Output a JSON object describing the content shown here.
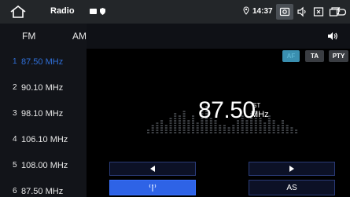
{
  "statusbar": {
    "title": "Radio",
    "time": "14:37",
    "icons": [
      "home-icon",
      "sd-card-icon",
      "shield-icon",
      "location-icon",
      "screenshot-icon",
      "volume-icon",
      "close-window-icon",
      "window-icon",
      "back-icon"
    ]
  },
  "bands": {
    "fm": "FM",
    "am": "AM"
  },
  "presets": [
    {
      "num": "1",
      "freq": "87.50 MHz",
      "active": true
    },
    {
      "num": "2",
      "freq": "90.10 MHz"
    },
    {
      "num": "3",
      "freq": "98.10 MHz"
    },
    {
      "num": "4",
      "freq": "106.10 MHz"
    },
    {
      "num": "5",
      "freq": "108.00 MHz"
    },
    {
      "num": "6",
      "freq": "87.50 MHz"
    }
  ],
  "rds": {
    "af": "AF",
    "ta": "TA",
    "pty": "PTY"
  },
  "display": {
    "frequency": "87.50",
    "stereo": "ST",
    "unit": "MHz"
  },
  "controls": {
    "as": "AS"
  },
  "colors": {
    "accent": "#2e63e6",
    "preset_active": "#2f6fd8",
    "af": "#3a8fb0"
  }
}
